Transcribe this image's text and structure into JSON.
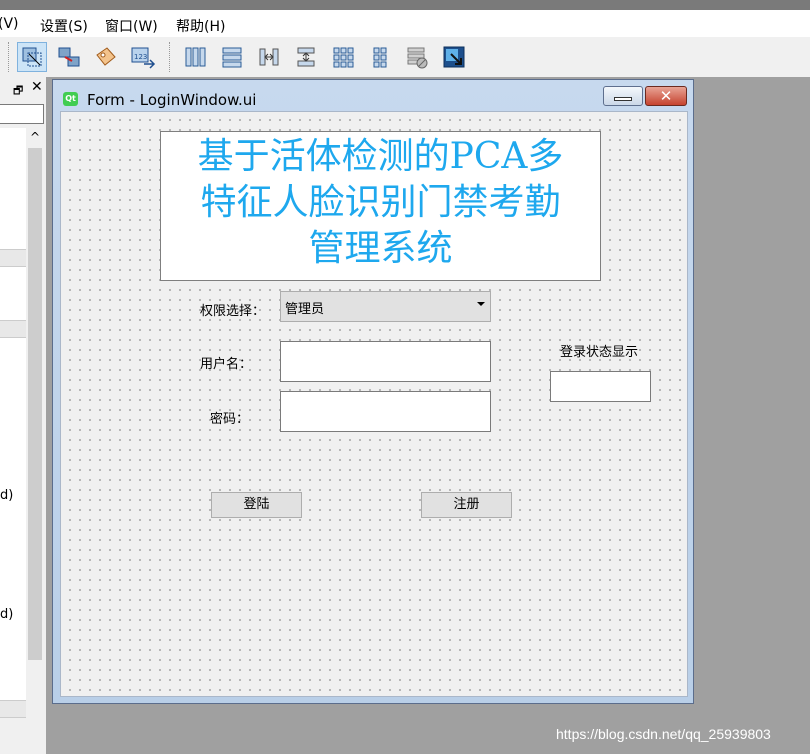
{
  "menubar": {
    "items": [
      {
        "label": "(V)"
      },
      {
        "label": "设置(S)"
      },
      {
        "label": "窗口(W)"
      },
      {
        "label": "帮助(H)"
      }
    ]
  },
  "dock": {
    "float_icon": "🗗",
    "close_icon": "✕",
    "scroll_up": "^",
    "cut_text_1": "d)",
    "cut_text_2": "d)"
  },
  "window": {
    "title": "Form - LoginWindow.ui",
    "icon_text": "Qt",
    "close_glyph": "✕"
  },
  "form": {
    "title_lines": [
      "基于活体检测的PCA多",
      "特征人脸识别门禁考勤",
      "管理系统"
    ],
    "permission_label": "权限选择：",
    "permission_value": "管理员",
    "username_label": "用户名：",
    "username_value": "",
    "password_label": "密码：",
    "password_value": "",
    "status_label": "登录状态显示",
    "status_value": "",
    "login_button": "登陆",
    "register_button": "注册"
  },
  "watermark": "https://blog.csdn.net/qq_25939803",
  "colors": {
    "title_text": "#1ea8ee",
    "window_frame": "#c7d9ee",
    "close_button": "#c6432f"
  }
}
